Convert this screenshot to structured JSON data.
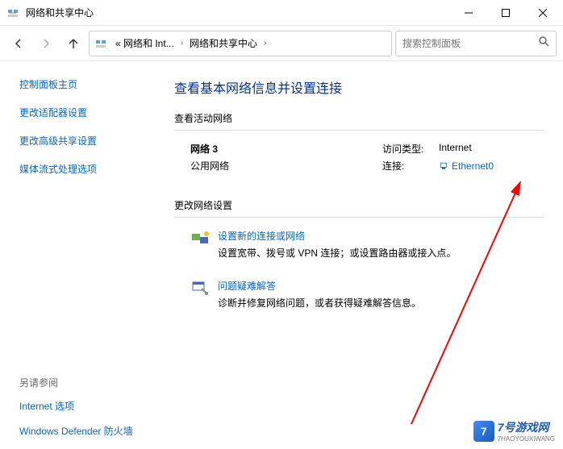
{
  "titlebar": {
    "title": "网络和共享中心"
  },
  "breadcrumb": {
    "seg1": "« 网络和 Int...",
    "seg2": "网络和共享中心"
  },
  "search": {
    "placeholder": "搜索控制面板"
  },
  "sidebar": {
    "home": "控制面板主页",
    "adapter": "更改适配器设置",
    "advanced": "更改高级共享设置",
    "streaming": "媒体流式处理选项",
    "see_also": "另请参阅",
    "internet_options": "Internet 选项",
    "firewall": "Windows Defender 防火墙"
  },
  "main": {
    "heading": "查看基本网络信息并设置连接",
    "active_title": "查看活动网络",
    "network": {
      "name": "网络 3",
      "type": "公用网络",
      "access_k": "访问类型:",
      "access_v": "Internet",
      "conn_k": "连接:",
      "conn_v": "Ethernet0"
    },
    "change_title": "更改网络设置",
    "item1": {
      "title": "设置新的连接或网络",
      "desc": "设置宽带、拨号或 VPN 连接；或设置路由器或接入点。"
    },
    "item2": {
      "title": "问题疑难解答",
      "desc": "诊断并修复网络问题，或者获得疑难解答信息。"
    }
  },
  "watermark": {
    "brand": "7号游戏网",
    "sub": "7HAOYOUXIWANG"
  }
}
